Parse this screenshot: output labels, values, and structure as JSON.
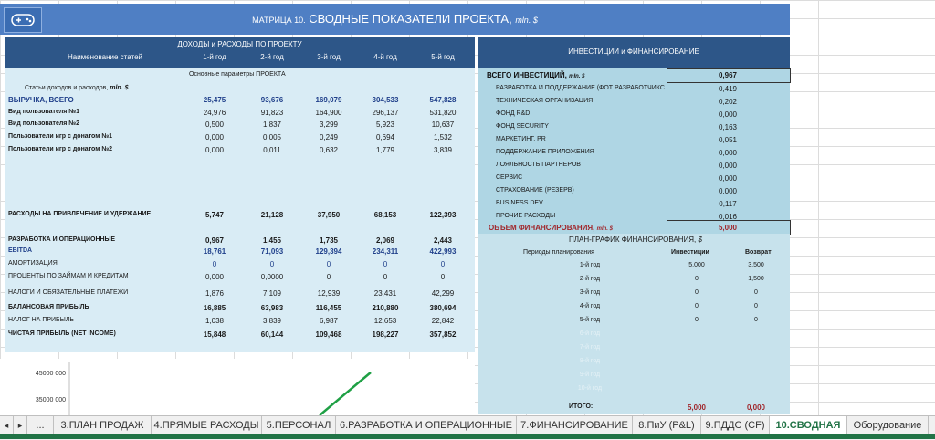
{
  "banner": {
    "title_prefix": "МАТРИЦА 10.",
    "title_main": " СВОДНЫЕ ПОКАЗАТЕЛИ ПРОЕКТА, ",
    "title_unit": "mln. $"
  },
  "left": {
    "subtitle": "ДОХОДЫ и РАСХОДЫ ПО ПРОЕКТУ",
    "name_header": "Наименование статей",
    "years": [
      "1-й год",
      "2-й год",
      "3-й год",
      "4-й год",
      "5-й год"
    ],
    "params_title": "Основные параметры ПРОЕКТА",
    "items_title": "Статьи доходов и расходов,",
    "items_unit": "mln. $",
    "rows": [
      {
        "label": "ВЫРУЧКА, ВСЕГО",
        "values": [
          "25,475",
          "93,676",
          "169,079",
          "304,533",
          "547,828"
        ]
      },
      {
        "label": "Вид пользователя №1",
        "values": [
          "24,976",
          "91,823",
          "164,900",
          "296,137",
          "531,820"
        ]
      },
      {
        "label": "Вид пользователя №2",
        "values": [
          "0,500",
          "1,837",
          "3,299",
          "5,923",
          "10,637"
        ]
      },
      {
        "label": "Пользователи игр с донатом №1",
        "values": [
          "0,000",
          "0,005",
          "0,249",
          "0,694",
          "1,532"
        ]
      },
      {
        "label": "Пользователи игр с донатом №2",
        "values": [
          "0,000",
          "0,011",
          "0,632",
          "1,779",
          "3,839"
        ]
      },
      {
        "label": "РАСХОДЫ НА ПРИВЛЕЧЕНИЕ И УДЕРЖАНИЕ",
        "values": [
          "5,747",
          "21,128",
          "37,950",
          "68,153",
          "122,393"
        ]
      },
      {
        "label": "РАЗРАБОТКА И ОПЕРАЦИОННЫЕ",
        "values": [
          "0,967",
          "1,455",
          "1,735",
          "2,069",
          "2,443"
        ]
      },
      {
        "label": "EBITDA",
        "values": [
          "18,761",
          "71,093",
          "129,394",
          "234,311",
          "422,993"
        ]
      },
      {
        "label": "АМОРТИЗАЦИЯ",
        "values": [
          "0",
          "0",
          "0",
          "0",
          "0"
        ]
      },
      {
        "label": "ПРОЦЕНТЫ ПО ЗАЙМАМ И КРЕДИТАМ",
        "values": [
          "0,000",
          "0,0000",
          "0",
          "0",
          "0"
        ]
      },
      {
        "label": "НАЛОГИ И ОБЯЗАТЕЛЬНЫЕ ПЛАТЕЖИ",
        "values": [
          "1,876",
          "7,109",
          "12,939",
          "23,431",
          "42,299"
        ]
      },
      {
        "label": "БАЛАНСОВАЯ ПРИБЫЛЬ",
        "values": [
          "16,885",
          "63,983",
          "116,455",
          "210,880",
          "380,694"
        ]
      },
      {
        "label": "НАЛОГ НА ПРИБЫЛЬ",
        "values": [
          "1,038",
          "3,839",
          "6,987",
          "12,653",
          "22,842"
        ]
      },
      {
        "label": "ЧИСТАЯ ПРИБЫЛЬ (NET INCOME)",
        "values": [
          "15,848",
          "60,144",
          "109,468",
          "198,227",
          "357,852"
        ]
      }
    ]
  },
  "right": {
    "header": "ИНВЕСТИЦИИ и ФИНАНСИРОВАНИЕ",
    "total_label": "ВСЕГО ИНВЕСТИЦИЙ,",
    "total_unit": "mln. $",
    "total_value": "0,967",
    "items": [
      {
        "label": "РАЗРАБОТКА И ПОДДЕРЖАНИЕ (ФОТ РАЗРАБОТЧИКС",
        "value": "0,419"
      },
      {
        "label": "ТЕХНИЧЕСКАЯ ОРГАНИЗАЦИЯ",
        "value": "0,202"
      },
      {
        "label": "ФОНД R&D",
        "value": "0,000"
      },
      {
        "label": "ФОНД SECURITY",
        "value": "0,163"
      },
      {
        "label": "МАРКЕТИНГ, PR",
        "value": "0,051"
      },
      {
        "label": "ПОДДЕРЖАНИЕ ПРИЛОЖЕНИЯ",
        "value": "0,000"
      },
      {
        "label": "ЛОЯЛЬНОСТЬ ПАРТНЕРОВ",
        "value": "0,000"
      },
      {
        "label": "СЕРВИС",
        "value": "0,000"
      },
      {
        "label": "СТРАХОВАНИЕ (РЕЗЕРВ)",
        "value": "0,000"
      },
      {
        "label": "BUSINESS DEV",
        "value": "0,117"
      },
      {
        "label": "ПРОЧИЕ РАСХОДЫ",
        "value": "0,016"
      }
    ],
    "finance_label": "ОБЪЕМ ФИНАНСИРОВАНИЯ,",
    "finance_unit": "mln. $",
    "finance_value": "5,000",
    "schedule_title": "ПЛАН-ГРАФИК ФИНАНСИРОВАНИЯ,",
    "schedule_unit": "$",
    "schedule_headers": [
      "Периоды планирования",
      "Инвестиции",
      "Возврат"
    ],
    "schedule": [
      {
        "period": "1-й год",
        "inv": "5,000",
        "ret": "3,500"
      },
      {
        "period": "2-й год",
        "inv": "0",
        "ret": "1,500"
      },
      {
        "period": "3-й год",
        "inv": "0",
        "ret": "0"
      },
      {
        "period": "4-й год",
        "inv": "0",
        "ret": "0"
      },
      {
        "period": "5-й год",
        "inv": "0",
        "ret": "0"
      }
    ],
    "faded_periods": [
      "6-й год",
      "7-й год",
      "8-й год",
      "9-й год",
      "10-й год"
    ],
    "total_row": {
      "label": "ИТОГО:",
      "inv": "5,000",
      "ret": "0,000"
    }
  },
  "chart_data": {
    "type": "line",
    "ytick_labels": [
      "45000 000",
      "35000 000"
    ],
    "series": [
      {
        "values_visible": "partial line segment rising"
      }
    ]
  },
  "sheet_tabs": {
    "ellipsis": "...",
    "tabs": [
      "3.ПЛАН ПРОДАЖ",
      "4.ПРЯМЫЕ РАСХОДЫ",
      "5.ПЕРСОНАЛ",
      "6.РАЗРАБОТКА И ОПЕРАЦИОННЫЕ",
      "7.ФИНАНСИРОВАНИЕ",
      "8.ПиУ (P&L)",
      "9.ПДДС (CF)",
      "10.СВОДНАЯ",
      "Оборудование"
    ]
  },
  "colors": {
    "accent_green": "#217346",
    "header_blue": "#2d5688",
    "panel_blue": "#d9ecf5",
    "dark_red": "#a0262b"
  }
}
